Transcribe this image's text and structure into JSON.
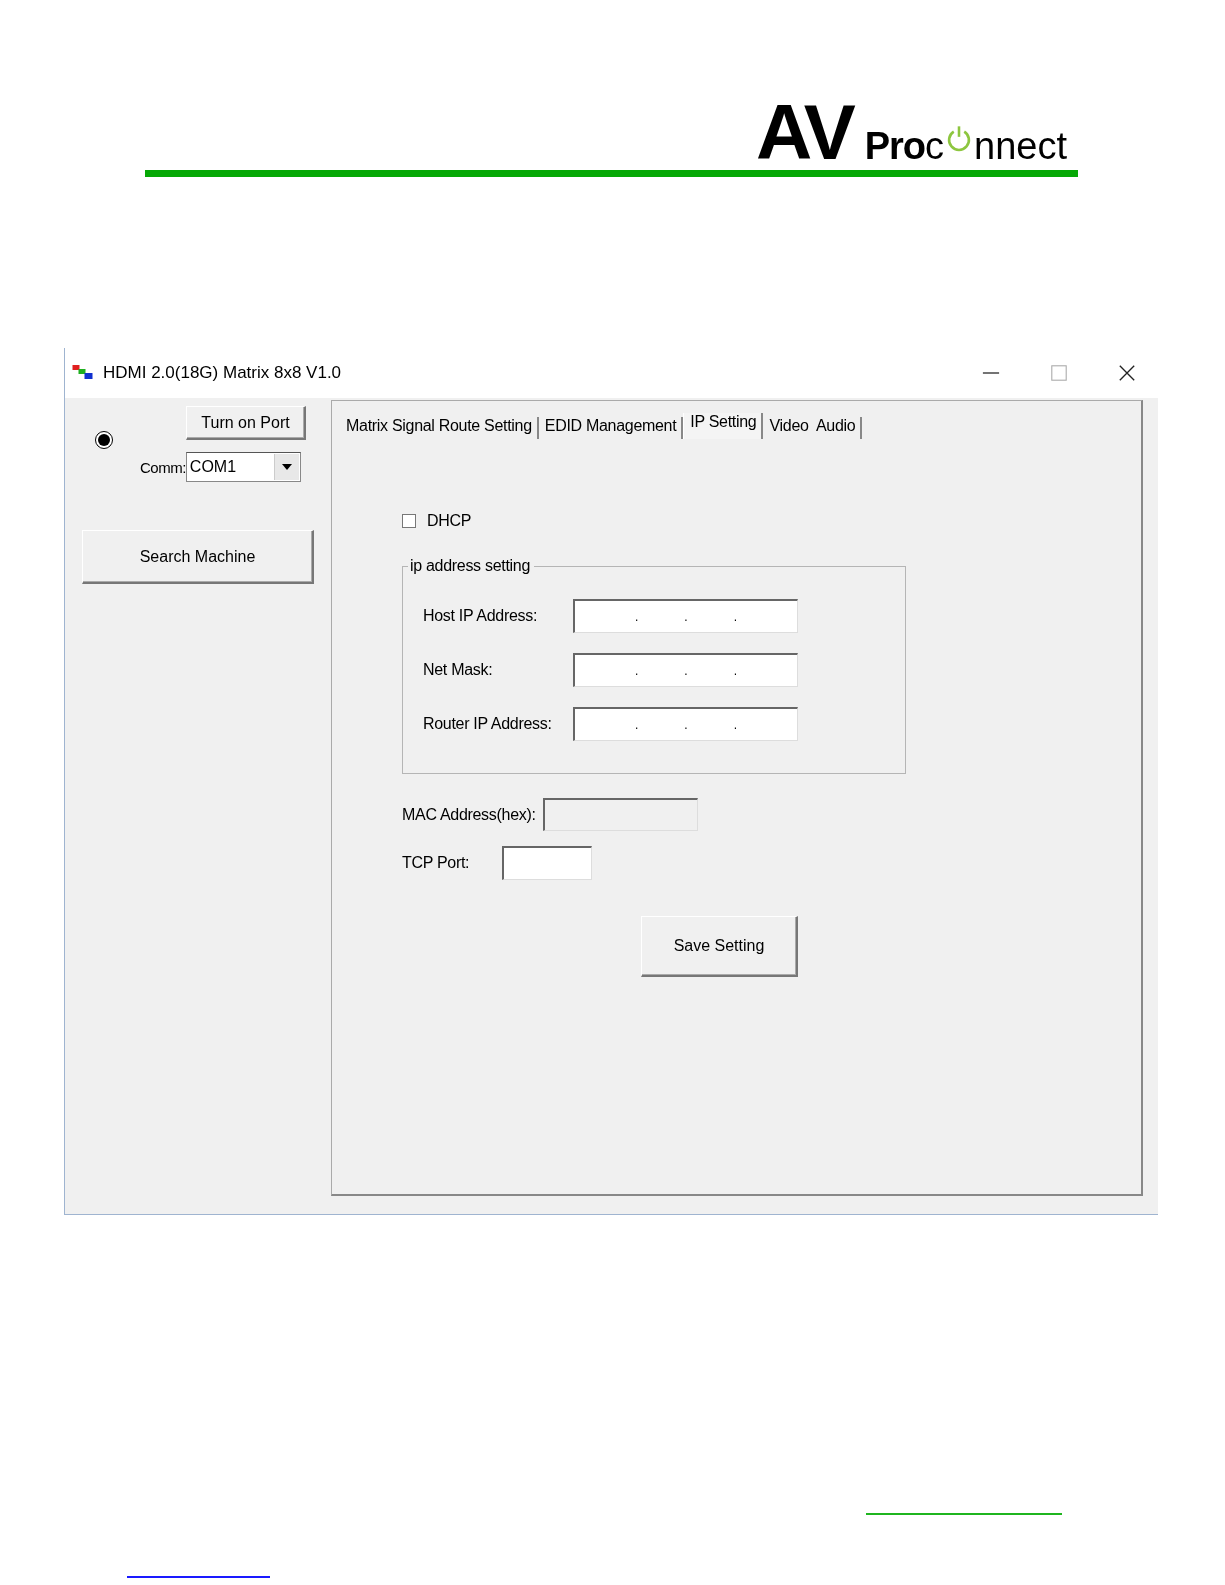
{
  "logo": {
    "mark": "AV",
    "bold_word": "Pro",
    "word_start": "c",
    "word_end": "nnect"
  },
  "window": {
    "title": "HDMI 2.0(18G) Matrix 8x8 V1.0"
  },
  "left_panel": {
    "connected": true,
    "turn_on_button": "Turn on Port",
    "comm_label": "Comm:",
    "comm_value": "COM1",
    "search_button": "Search Machine"
  },
  "tabs": [
    {
      "label": "Matrix Signal Route Setting",
      "selected": false
    },
    {
      "label": "EDID Management",
      "selected": false
    },
    {
      "label": "IP Setting",
      "selected": true
    },
    {
      "label": "Video  Audio",
      "selected": false
    }
  ],
  "dhcp": {
    "label": "DHCP",
    "checked": false
  },
  "ip_group": {
    "legend": "ip address setting",
    "fields": [
      {
        "label": "Host IP Address:",
        "dots": [
          ".",
          ".",
          "."
        ]
      },
      {
        "label": "Net Mask:",
        "dots": [
          ".",
          ".",
          "."
        ]
      },
      {
        "label": "Router IP Address:",
        "dots": [
          ".",
          ".",
          "."
        ]
      }
    ]
  },
  "mac": {
    "label": "MAC Address(hex):",
    "disabled": true
  },
  "tcp_port": {
    "label": "TCP Port:",
    "disabled": false
  },
  "save_button": "Save Setting"
}
